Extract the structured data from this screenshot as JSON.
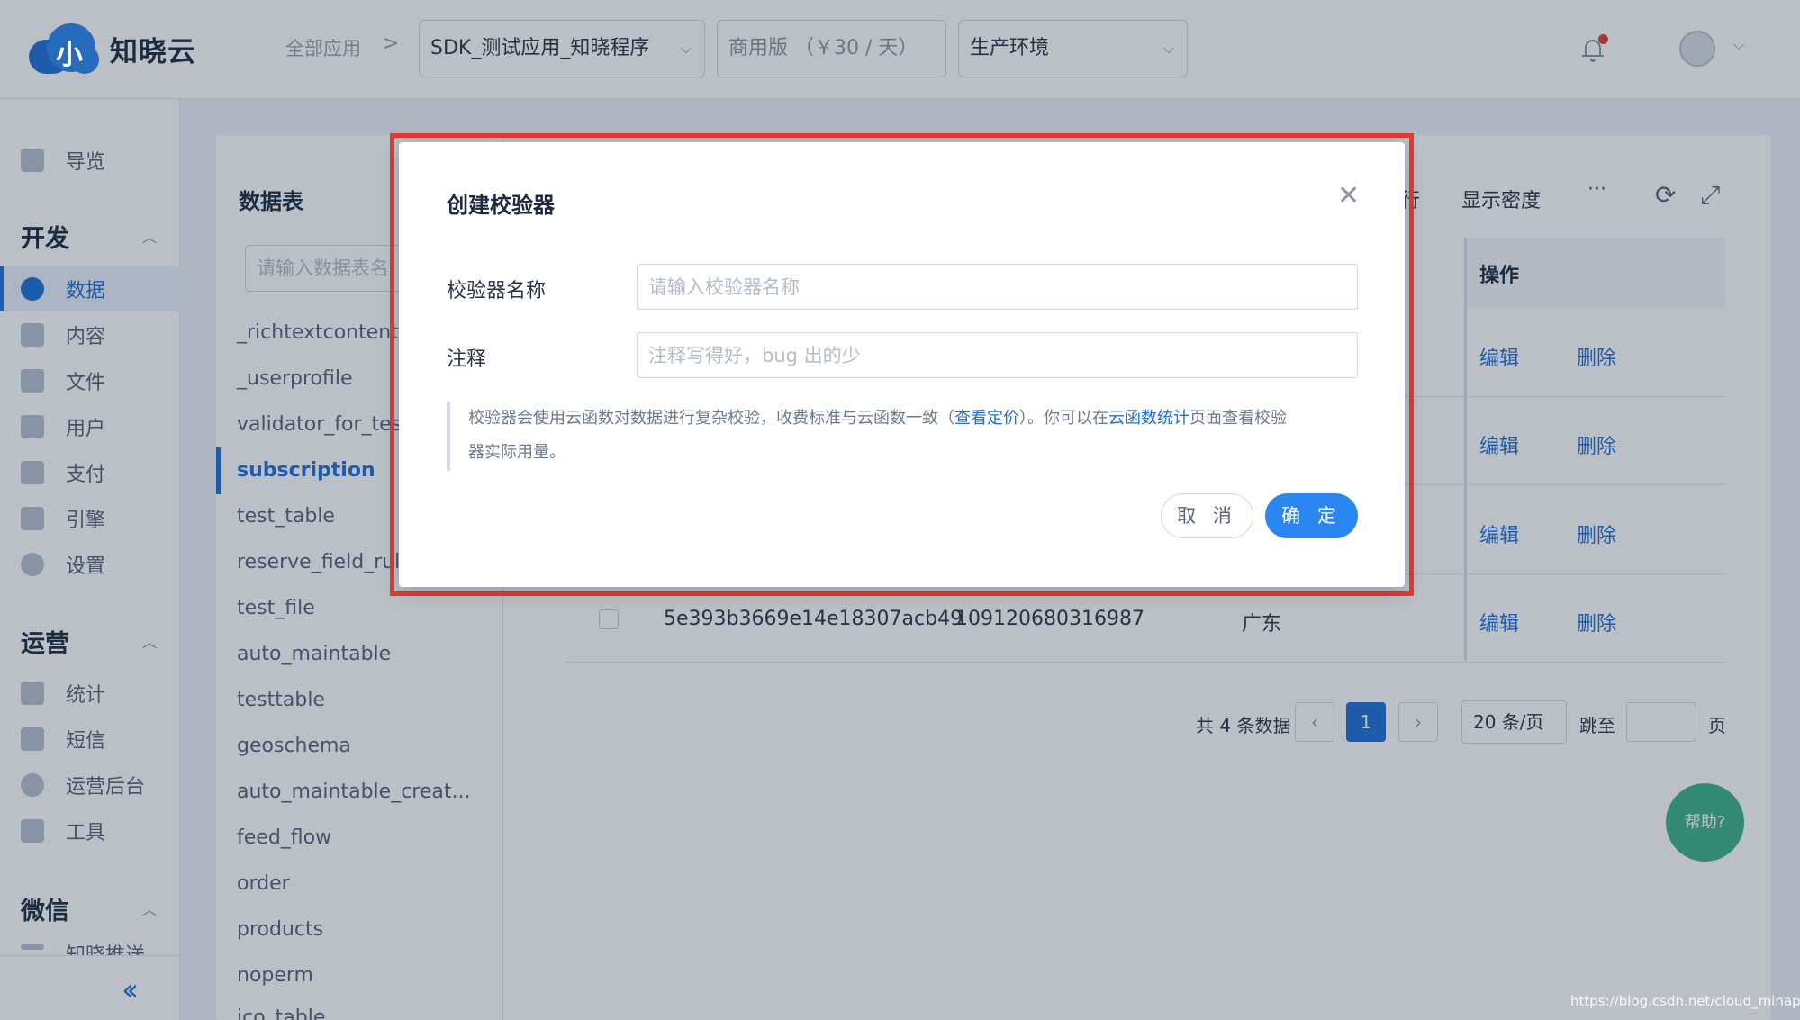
{
  "header": {
    "logo_glyph": "小",
    "brand": "知晓云",
    "breadcrumb_all": "全部应用",
    "breadcrumb_sep": ">",
    "app_select": "SDK_测试应用_知晓程序",
    "plan_select": "商用版 （￥30 / 天）",
    "env_select": "生产环境"
  },
  "sidebar": {
    "overview": "导览",
    "group_dev": "开发",
    "items_dev": [
      "数据",
      "内容",
      "文件",
      "用户",
      "支付",
      "引擎",
      "设置"
    ],
    "group_ops": "运营",
    "items_ops": [
      "统计",
      "短信",
      "运营后台",
      "工具"
    ],
    "group_wechat": "微信",
    "items_wechat": [
      "知晓推送"
    ],
    "collapse": "«"
  },
  "tables": {
    "title": "数据表",
    "search_placeholder": "请输入数据表名",
    "names": [
      "_richtextcontent",
      "_userprofile",
      "validator_for_test",
      "subscription",
      "test_table",
      "reserve_field_rule",
      "test_file",
      "auto_maintable",
      "testtable",
      "geoschema",
      "auto_maintable_creat...",
      "feed_flow",
      "order",
      "products",
      "noperm",
      "ico_table"
    ],
    "active_index": 3
  },
  "toolbar": {
    "density": "显示密度",
    "more": "···",
    "refresh": "⟳",
    "expand": "⤢",
    "partial": "行"
  },
  "grid": {
    "ops_header": "操作",
    "edit": "编辑",
    "delete": "删除",
    "last_row": {
      "id": "5e393b3669e14e18307acb49",
      "num": "109120680316987",
      "region": "广东"
    }
  },
  "pager": {
    "total": "共 4 条数据",
    "prev": "‹",
    "current": "1",
    "next": "›",
    "size": "20 条/页",
    "jump": "跳至",
    "page_unit": "页"
  },
  "help": "帮助?",
  "modal": {
    "title": "创建校验器",
    "close": "✕",
    "name_label": "校验器名称",
    "name_placeholder": "请输入校验器名称",
    "note_label": "注释",
    "note_placeholder": "注释写得好，bug 出的少",
    "notice_1": "校验器会使用云函数对数据进行复杂校验，收费标准与云函数一致（",
    "notice_link_1": "查看定价",
    "notice_2": "）。你可以在",
    "notice_link_2": "云函数统计",
    "notice_3": "页面查看校验",
    "notice_4": "器实际用量。",
    "cancel": "取 消",
    "ok": "确 定"
  },
  "watermark": "https://blog.csdn.net/cloud_minapp",
  "colors": {
    "accent": "#1f6fd6",
    "highlight": "#e23c2f",
    "help": "#3fb28a"
  }
}
